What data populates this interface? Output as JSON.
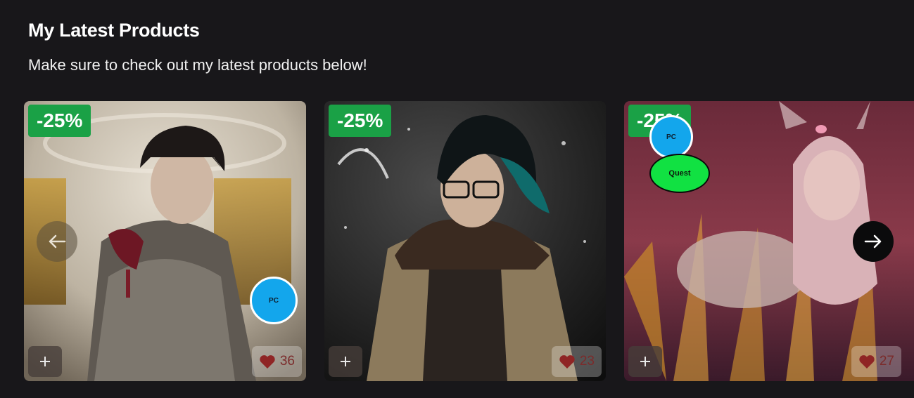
{
  "section": {
    "title": "My Latest Products",
    "subtitle": "Make sure to check out my latest products below!"
  },
  "carousel": {
    "prev_icon": "arrow-left-icon",
    "next_icon": "arrow-right-icon"
  },
  "products": [
    {
      "discount": "-25%",
      "likes": "36",
      "platforms": [
        "PC"
      ],
      "add_icon": "plus-icon",
      "like_icon": "heart-icon"
    },
    {
      "discount": "-25%",
      "likes": "23",
      "platforms": [],
      "add_icon": "plus-icon",
      "like_icon": "heart-icon"
    },
    {
      "discount": "-25%",
      "likes": "27",
      "platforms": [
        "PC",
        "Quest"
      ],
      "add_icon": "plus-icon",
      "like_icon": "heart-icon"
    }
  ],
  "colors": {
    "background": "#18171a",
    "discount_badge": "#1aa146",
    "pc_badge": "#13a6ec",
    "quest_badge": "#11e142",
    "heart": "#8f2525"
  }
}
